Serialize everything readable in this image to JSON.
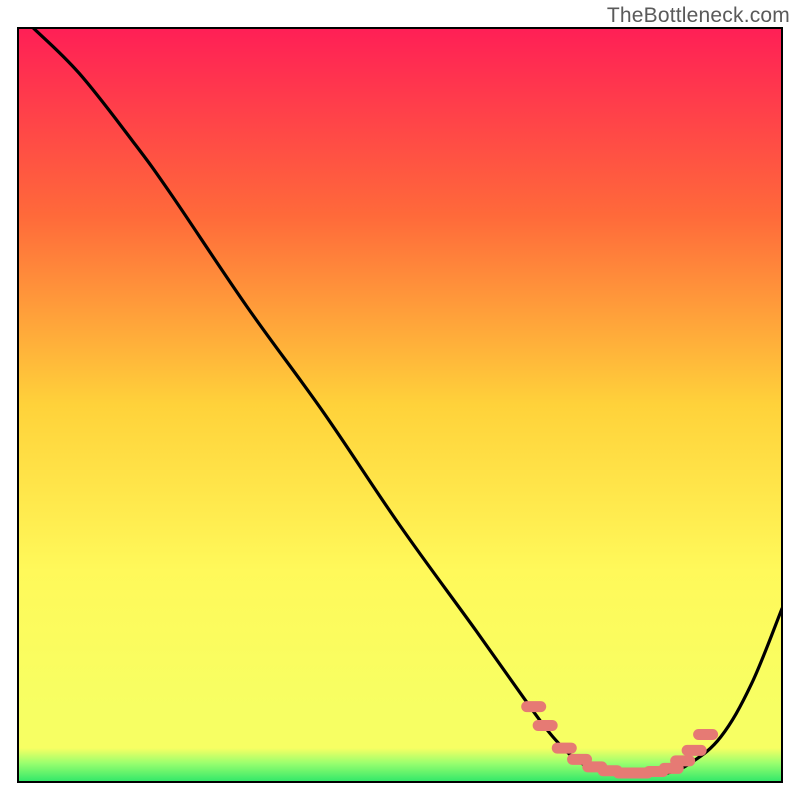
{
  "watermark": "TheBottleneck.com",
  "colors": {
    "gradient_top": "#ff1f56",
    "gradient_upper": "#ff6a3a",
    "gradient_mid": "#ffd23a",
    "gradient_lower": "#fff95a",
    "gradient_base_yellow": "#f7ff63",
    "gradient_green_light": "#9aff6e",
    "gradient_green": "#2fe76a",
    "curve": "#000000",
    "marker": "#e67a74",
    "border": "#000000"
  },
  "chart_data": {
    "type": "line",
    "title": "",
    "xlabel": "",
    "ylabel": "",
    "xlim": [
      0,
      100
    ],
    "ylim": [
      0,
      100
    ],
    "grid": false,
    "legend": false,
    "series": [
      {
        "name": "bottleneck-curve",
        "x": [
          2,
          8,
          15,
          20,
          30,
          40,
          50,
          60,
          67,
          70,
          73,
          76,
          79,
          82,
          85,
          88,
          92,
          96,
          100
        ],
        "y": [
          100,
          94,
          85,
          78,
          63,
          49,
          34,
          20,
          10,
          6,
          3,
          1.5,
          1,
          1,
          1.2,
          2.5,
          6,
          13,
          23
        ]
      }
    ],
    "markers": [
      {
        "name": "optimal-region-dots",
        "x": [
          67.5,
          69,
          71.5,
          73.5,
          75.5,
          77.5,
          79.5,
          81.5,
          83.5,
          85.5,
          87,
          88.5,
          90
        ],
        "y": [
          10,
          7.5,
          4.5,
          3,
          2,
          1.5,
          1.2,
          1.2,
          1.4,
          1.8,
          2.8,
          4.2,
          6.3
        ]
      }
    ],
    "annotations": []
  }
}
